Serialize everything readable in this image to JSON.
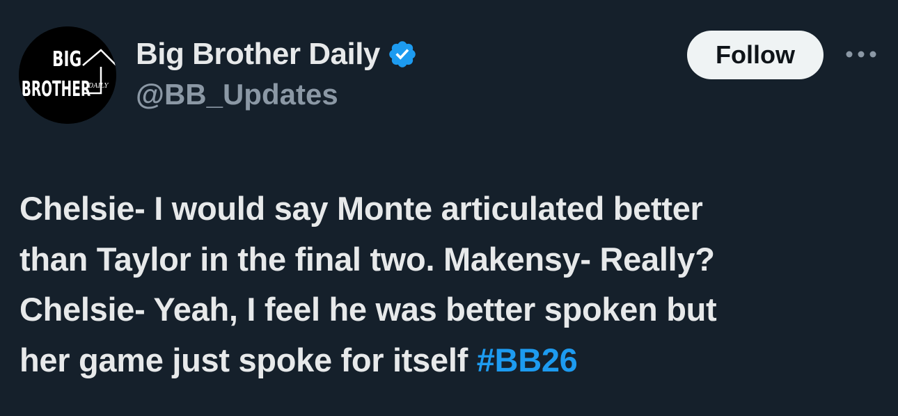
{
  "author": {
    "display_name": "Big Brother Daily",
    "handle": "@BB_Updates",
    "verified": true,
    "avatar": {
      "logo_line1": "BIG",
      "logo_line2": "BROTHER",
      "logo_tag": "DAILY"
    }
  },
  "actions": {
    "follow_label": "Follow",
    "more_icon": "more-horizontal-icon"
  },
  "tweet": {
    "lines": [
      "Chelsie- I would say Monte articulated better",
      "than Taylor in the final two. Makensy- Really?",
      "Chelsie- Yeah, I feel he was better spoken but",
      "her game just spoke for itself"
    ],
    "hashtag": "#BB26"
  },
  "colors": {
    "background": "#15202b",
    "text_primary": "#e7e9ea",
    "text_secondary": "#8b98a5",
    "accent": "#1d9bf0",
    "follow_button_bg": "#eff3f4",
    "follow_button_text": "#0f1419"
  }
}
